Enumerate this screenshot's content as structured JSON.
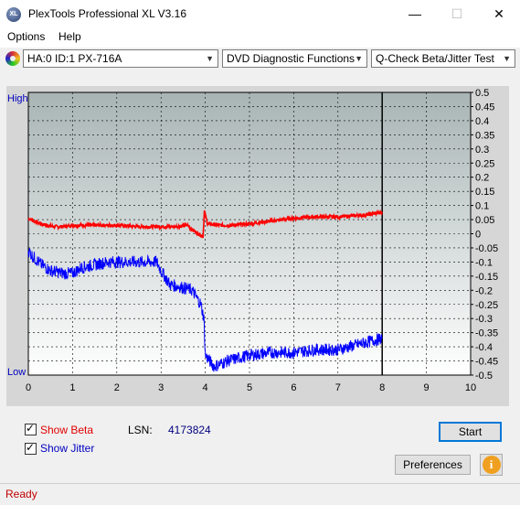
{
  "window": {
    "title": "PlexTools Professional XL V3.16",
    "icon_text": "XL",
    "min_glyph": "—",
    "max_glyph": "☐",
    "close_glyph": "✕"
  },
  "menu": {
    "options": "Options",
    "help": "Help"
  },
  "toolbar": {
    "drive": "HA:0 ID:1  PX-716A",
    "function": "DVD Diagnostic Functions",
    "test": "Q-Check Beta/Jitter Test"
  },
  "chart_data": {
    "type": "line",
    "high_label": "High",
    "low_label": "Low",
    "x_ticks": [
      "0",
      "1",
      "2",
      "3",
      "4",
      "5",
      "6",
      "7",
      "8",
      "9",
      "10"
    ],
    "xlim": [
      0,
      10
    ],
    "y_ticks": [
      "0.5",
      "0.45",
      "0.4",
      "0.35",
      "0.3",
      "0.25",
      "0.2",
      "0.15",
      "0.1",
      "0.05",
      "0",
      "-0.05",
      "-0.1",
      "-0.15",
      "-0.2",
      "-0.25",
      "-0.3",
      "-0.35",
      "-0.4",
      "-0.45",
      "-0.5"
    ],
    "ylim": [
      -0.5,
      0.5
    ],
    "grid": true,
    "end_marker_x": 8,
    "series": [
      {
        "color": "#ff0000",
        "points": [
          [
            0,
            0.055
          ],
          [
            0.2,
            0.04
          ],
          [
            0.4,
            0.03
          ],
          [
            0.6,
            0.025
          ],
          [
            0.8,
            0.025
          ],
          [
            1.0,
            0.03
          ],
          [
            1.5,
            0.03
          ],
          [
            2.0,
            0.03
          ],
          [
            2.5,
            0.025
          ],
          [
            3.0,
            0.025
          ],
          [
            3.3,
            0.025
          ],
          [
            3.6,
            0.03
          ],
          [
            3.7,
            0.015
          ],
          [
            3.9,
            -0.005
          ],
          [
            3.95,
            -0.01
          ],
          [
            3.98,
            0.08
          ],
          [
            4.05,
            0.035
          ],
          [
            4.3,
            0.03
          ],
          [
            4.6,
            0.03
          ],
          [
            5.0,
            0.035
          ],
          [
            5.5,
            0.045
          ],
          [
            6.0,
            0.055
          ],
          [
            6.5,
            0.06
          ],
          [
            7.0,
            0.06
          ],
          [
            7.5,
            0.065
          ],
          [
            8.0,
            0.075
          ]
        ]
      },
      {
        "color": "#0000ff",
        "points": [
          [
            0,
            -0.06
          ],
          [
            0.1,
            -0.08
          ],
          [
            0.3,
            -0.11
          ],
          [
            0.5,
            -0.13
          ],
          [
            0.8,
            -0.14
          ],
          [
            1.0,
            -0.14
          ],
          [
            1.2,
            -0.12
          ],
          [
            1.5,
            -0.11
          ],
          [
            1.8,
            -0.1
          ],
          [
            2.0,
            -0.1
          ],
          [
            2.5,
            -0.1
          ],
          [
            2.9,
            -0.1
          ],
          [
            3.0,
            -0.13
          ],
          [
            3.2,
            -0.18
          ],
          [
            3.5,
            -0.19
          ],
          [
            3.7,
            -0.2
          ],
          [
            3.9,
            -0.25
          ],
          [
            3.97,
            -0.3
          ],
          [
            4.0,
            -0.43
          ],
          [
            4.2,
            -0.47
          ],
          [
            4.5,
            -0.45
          ],
          [
            5.0,
            -0.43
          ],
          [
            5.5,
            -0.42
          ],
          [
            6.0,
            -0.42
          ],
          [
            6.5,
            -0.41
          ],
          [
            7.0,
            -0.41
          ],
          [
            7.5,
            -0.39
          ],
          [
            8.0,
            -0.37
          ]
        ]
      }
    ]
  },
  "controls": {
    "show_beta_label": "Show Beta",
    "show_beta_checked": true,
    "show_jitter_label": "Show Jitter",
    "show_jitter_checked": true,
    "lsn_label": "LSN:",
    "lsn_value": "4173824",
    "start_label": "Start",
    "preferences_label": "Preferences",
    "info_glyph": "i",
    "check_glyph": "✓"
  },
  "status": {
    "text": "Ready"
  }
}
